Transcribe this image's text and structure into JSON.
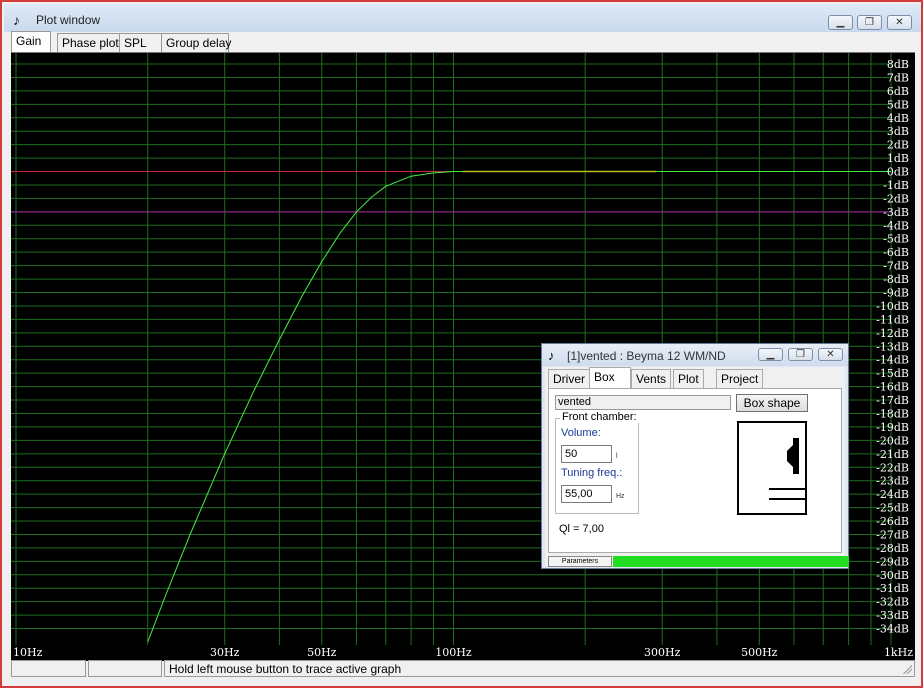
{
  "window": {
    "title": "Plot window",
    "icon": "app-icon",
    "buttons": [
      "minimize",
      "restore",
      "close"
    ]
  },
  "tabs": [
    "Gain",
    "Phase plot",
    "SPL",
    "Group delay"
  ],
  "active_tab": "Gain",
  "chart_data": {
    "type": "line",
    "x_scale": "log",
    "x_ticks": [
      {
        "value": 10,
        "label": "10Hz"
      },
      {
        "value": 30,
        "label": "30Hz"
      },
      {
        "value": 50,
        "label": "50Hz"
      },
      {
        "value": 100,
        "label": "100Hz"
      },
      {
        "value": 300,
        "label": "300Hz"
      },
      {
        "value": 500,
        "label": "500Hz"
      },
      {
        "value": 1000,
        "label": "1kHz"
      }
    ],
    "xlim": [
      10,
      1000
    ],
    "ylim": [
      -35,
      8
    ],
    "y_ticks": [
      8,
      7,
      6,
      5,
      4,
      3,
      2,
      1,
      0,
      -1,
      -2,
      -3,
      -4,
      -5,
      -6,
      -7,
      -8,
      -9,
      -10,
      -11,
      -12,
      -13,
      -14,
      -15,
      -16,
      -17,
      -18,
      -19,
      -20,
      -21,
      -22,
      -23,
      -24,
      -25,
      -26,
      -27,
      -28,
      -29,
      -30,
      -31,
      -32,
      -33,
      -34
    ],
    "y_unit": "dB",
    "grid": true,
    "reference_lines": [
      {
        "y": 0,
        "color": "#cc2244"
      },
      {
        "y": -3,
        "color": "#aa22aa"
      }
    ],
    "series": [
      {
        "color": "#44ee44",
        "x": [
          20,
          22,
          25,
          30,
          35,
          40,
          45,
          50,
          55,
          60,
          65,
          70,
          80,
          90,
          100,
          120,
          150,
          200,
          300,
          500,
          1000
        ],
        "y": [
          -35,
          -31.5,
          -27,
          -21,
          -16.3,
          -12.5,
          -9.3,
          -6.7,
          -4.6,
          -3,
          -1.9,
          -1.1,
          -0.35,
          -0.1,
          0,
          0,
          0,
          0,
          0,
          0,
          0
        ]
      }
    ],
    "highlight_segment": {
      "x": [
        105,
        290
      ],
      "color": "#bbbb22"
    }
  },
  "statusbar": {
    "message": "Hold left mouse button to trace active graph"
  },
  "dialog": {
    "title": "[1]vented : Beyma 12 WM/ND",
    "tabs": [
      "Driver",
      "Box",
      "Vents",
      "Plot",
      "Project"
    ],
    "active_tab": "Box",
    "box_type": "vented",
    "box_shape_button": "Box shape",
    "front_chamber_label": "Front chamber:",
    "volume_label": "Volume:",
    "volume_value": "50",
    "volume_unit": "l",
    "tuning_label": "Tuning freq.:",
    "tuning_value": "55,00",
    "tuning_unit": "Hz",
    "ql_text": "Ql = 7,00",
    "parameters_button": "Parameters",
    "progress": 1.0,
    "progress_color": "#22dd22"
  }
}
